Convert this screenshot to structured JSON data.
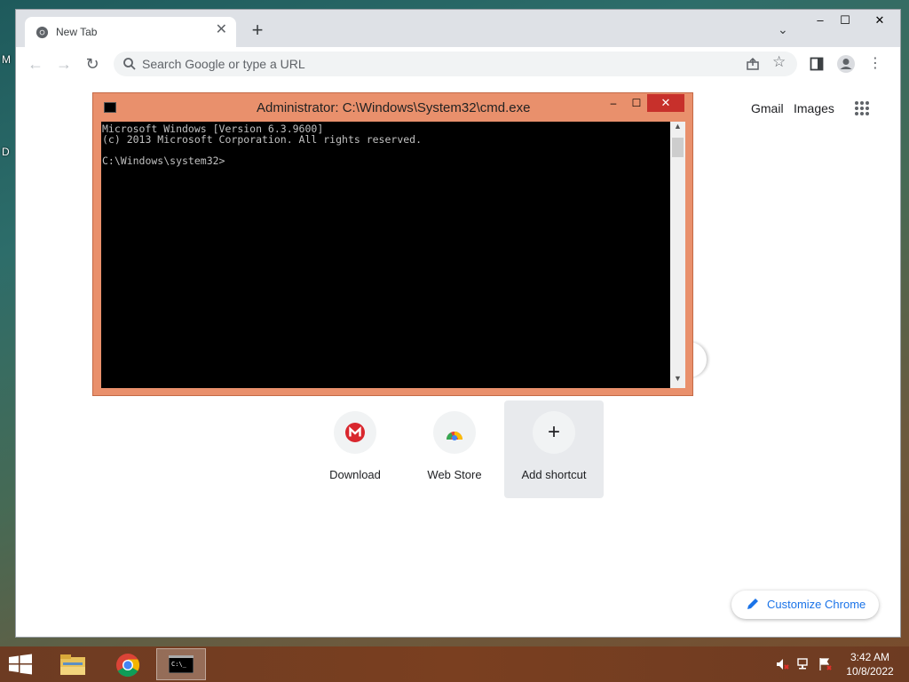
{
  "desktop": {
    "letters": [
      "M",
      "D"
    ]
  },
  "browser": {
    "tab_title": "New Tab",
    "new_tab_label": "+",
    "tab_close": "✕",
    "window_min": "‒",
    "window_max": "☐",
    "window_close": "✕",
    "omnibox_placeholder": "Search Google or type a URL",
    "top_links": {
      "gmail": "Gmail",
      "images": "Images"
    },
    "shortcuts": [
      {
        "label": "Download",
        "icon": "mega-icon"
      },
      {
        "label": "Web Store",
        "icon": "webstore-icon"
      },
      {
        "label": "Add shortcut",
        "icon": "plus-icon"
      }
    ],
    "add_glyph": "+",
    "customize_label": "Customize Chrome"
  },
  "cmd": {
    "title": "Administrator: C:\\Windows\\System32\\cmd.exe",
    "min": "‒",
    "max": "☐",
    "close": "✕",
    "console_text": "Microsoft Windows [Version 6.3.9600]\n(c) 2013 Microsoft Corporation. All rights reserved.\n\nC:\\Windows\\system32>"
  },
  "taskbar": {
    "clock_time": "3:42 AM",
    "clock_date": "10/8/2022"
  },
  "colors": {
    "cmd_frame": "#e9906c",
    "taskbar": "#6d3b22",
    "accent": "#1a73e8"
  }
}
